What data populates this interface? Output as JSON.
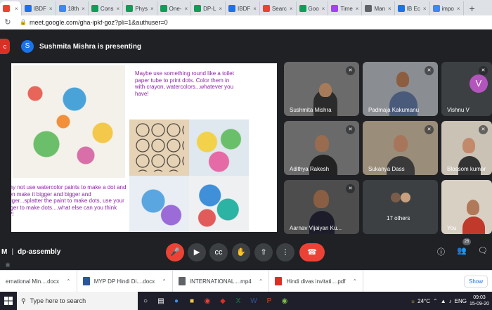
{
  "browser": {
    "tabs": [
      {
        "label": "",
        "color": "#ea4335"
      },
      {
        "label": "IBDF",
        "color": "#1a73e8"
      },
      {
        "label": "18th",
        "color": "#4285f4"
      },
      {
        "label": "Cons",
        "color": "#0f9d58"
      },
      {
        "label": "Phys",
        "color": "#0f9d58"
      },
      {
        "label": "One-",
        "color": "#0f9d58"
      },
      {
        "label": "DP-L",
        "color": "#0f9d58"
      },
      {
        "label": "IBDF",
        "color": "#1a73e8"
      },
      {
        "label": "Searc",
        "color": "#ea4335"
      },
      {
        "label": "Goo",
        "color": "#0f9d58"
      },
      {
        "label": "Time",
        "color": "#a142f4"
      },
      {
        "label": "Man",
        "color": "#5f6368"
      },
      {
        "label": "IB Ec",
        "color": "#1a73e8"
      },
      {
        "label": "impo",
        "color": "#4285f4"
      }
    ],
    "new_tab": "+",
    "url": "meet.google.com/gha-ipkf-goz?pli=1&authuser=0"
  },
  "presenting": {
    "avatar_letter": "S",
    "text": "Sushmita Mishra is presenting"
  },
  "slide": {
    "text_top": "Maybe use something round like a toilet paper tube to print dots. Color them in with crayon, watercolors...whatever you have!",
    "text_bottom": "Why not use watercolor paints to make a dot and then make it bigger and bigger and bigger...splatter the paint to make dots, use your finger to make dots....what else can you think of?!"
  },
  "participants": [
    {
      "name": "Sushmita Mishra",
      "muted": true
    },
    {
      "name": "Padmaja Kakumanu",
      "muted": true
    },
    {
      "name": "Vishnu V",
      "muted": true,
      "avatar_letter": "V"
    },
    {
      "name": "Adithya Rakesh",
      "muted": true
    },
    {
      "name": "Sukanya Dass",
      "muted": true
    },
    {
      "name": "Blossom kumar",
      "muted": true
    },
    {
      "name": "Aarnav Vijaiyan Ku...",
      "muted": true
    },
    {
      "name": "17 others",
      "muted": false
    },
    {
      "name": "You",
      "muted": false
    }
  ],
  "controls": {
    "meeting_prefix": "M",
    "meeting_name": "dp-assembly",
    "participant_count": "26"
  },
  "downloads": [
    {
      "name": "ernational Min....docx",
      "color": "#2b579a"
    },
    {
      "name": "MYP DP Hindi Di....docx",
      "color": "#2b579a"
    },
    {
      "name": "INTERNATIONAL....mp4",
      "color": "#5f6368"
    },
    {
      "name": "Hindi divas invitati....pdf",
      "color": "#d93025"
    }
  ],
  "show_all": "Show",
  "taskbar": {
    "search_placeholder": "Type here to search",
    "weather": "24°C",
    "language": "ENG",
    "time": "09:03",
    "date": "15-09-20"
  }
}
